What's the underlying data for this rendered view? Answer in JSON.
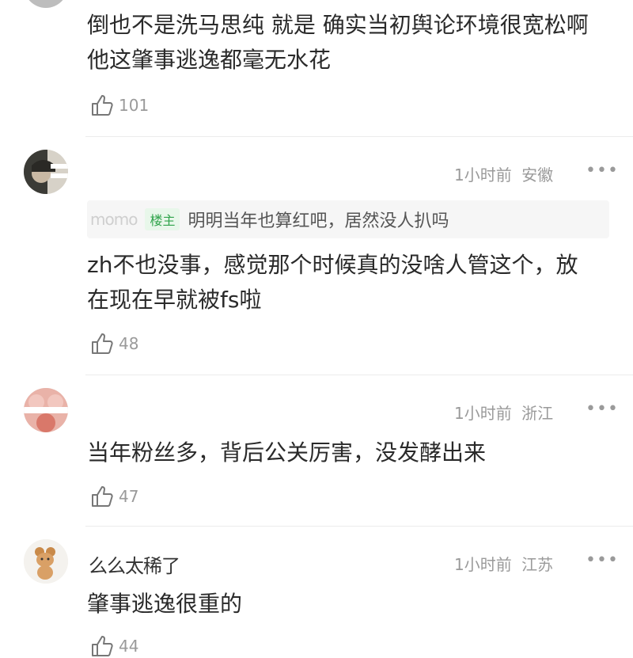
{
  "comments": [
    {
      "text_line1": "倒也不是洗马思纯 就是 确实当初舆论环境很宽松啊",
      "text_line2": "他这肇事逃逸都毫无水花",
      "likes": "101"
    },
    {
      "time": "1小时前",
      "location": "安徽",
      "quote_user": "momo",
      "op_badge": "楼主",
      "quote_text": "明明当年也算红吧，居然没人扒吗",
      "text_line1": "zh不也没事，感觉那个时候真的没啥人管这个，放",
      "text_line2": "在现在早就被fs啦",
      "likes": "48"
    },
    {
      "time": "1小时前",
      "location": "浙江",
      "text_line1": "当年粉丝多，背后公关厉害，没发酵出来",
      "likes": "47"
    },
    {
      "user": "么么太稀了",
      "time": "1小时前",
      "location": "江苏",
      "text_line1": "肇事逃逸很重的",
      "likes": "44"
    }
  ],
  "more_glyph": "•••"
}
